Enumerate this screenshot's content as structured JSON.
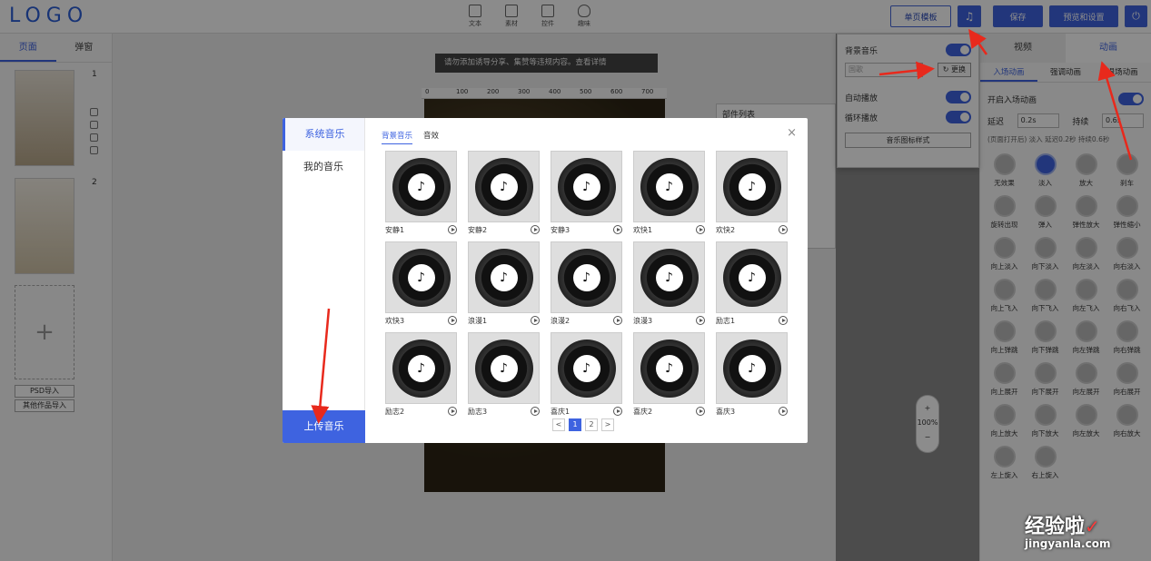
{
  "header": {
    "logo": "LOGO",
    "tools": [
      {
        "label": "文本",
        "icon": "text-icon"
      },
      {
        "label": "素材",
        "icon": "image-icon"
      },
      {
        "label": "控件",
        "icon": "widget-icon"
      },
      {
        "label": "趣味",
        "icon": "bulb-icon"
      }
    ],
    "single_template": "单页模板",
    "music_icon": "♫",
    "save": "保存",
    "preview_settings": "预览和设置",
    "power_icon": "⏻"
  },
  "left_panel": {
    "tabs": [
      "页面",
      "弹窗"
    ],
    "pages": [
      "1",
      "2"
    ],
    "psd_import": "PSD导入",
    "other_import": "其他作品导入"
  },
  "canvas": {
    "notice": "请勿添加诱导分享、集赞等违规内容。查看详情",
    "ruler": [
      "0",
      "100",
      "200",
      "300",
      "400",
      "500",
      "600",
      "700"
    ],
    "parts_list_title": "部件列表",
    "zoom_plus": "+",
    "zoom": "100%",
    "zoom_minus": "−"
  },
  "music_popup": {
    "bg_music": "背景音乐",
    "input_placeholder": "国歌",
    "change": "更换",
    "autoplay": "自动播放",
    "loop": "循环播放",
    "icon_style": "音乐图标样式"
  },
  "right_panel": {
    "tabs": [
      "视频",
      "动画"
    ],
    "subtabs": [
      "入场动画",
      "强调动画",
      "退场动画"
    ],
    "enable_entry": "开启入场动画",
    "delay_label": "延迟",
    "delay_value": "0.2s",
    "duration_label": "持续",
    "duration_value": "0.6s",
    "hint": "(页面打开后) 淡入 延迟0.2秒 持续0.6秒",
    "animations": [
      "无效果",
      "淡入",
      "放大",
      "刹车",
      "旋转出现",
      "弹入",
      "弹性放大",
      "弹性缩小",
      "向上淡入",
      "向下淡入",
      "向左淡入",
      "向右淡入",
      "向上飞入",
      "向下飞入",
      "向左飞入",
      "向右飞入",
      "向上弹跳",
      "向下弹跳",
      "向左弹跳",
      "向右弹跳",
      "向上展开",
      "向下展开",
      "向左展开",
      "向右展开",
      "向上放大",
      "向下放大",
      "向左放大",
      "向右放大",
      "左上旋入",
      "右上旋入"
    ]
  },
  "modal": {
    "sidebar": [
      "系统音乐",
      "我的音乐"
    ],
    "upload": "上传音乐",
    "tabs": [
      "背景音乐",
      "音效"
    ],
    "close_icon": "×",
    "music_note": "♪",
    "items": [
      "安静1",
      "安静2",
      "安静3",
      "欢快1",
      "欢快2",
      "欢快3",
      "浪漫1",
      "浪漫2",
      "浪漫3",
      "励志1",
      "励志2",
      "励志3",
      "喜庆1",
      "喜庆2",
      "喜庆3"
    ],
    "pager": {
      "prev": "<",
      "pages": [
        "1",
        "2"
      ],
      "next": ">"
    }
  },
  "watermark": {
    "cn": "经验啦",
    "check": "✓",
    "url": "jingyanla.com"
  }
}
